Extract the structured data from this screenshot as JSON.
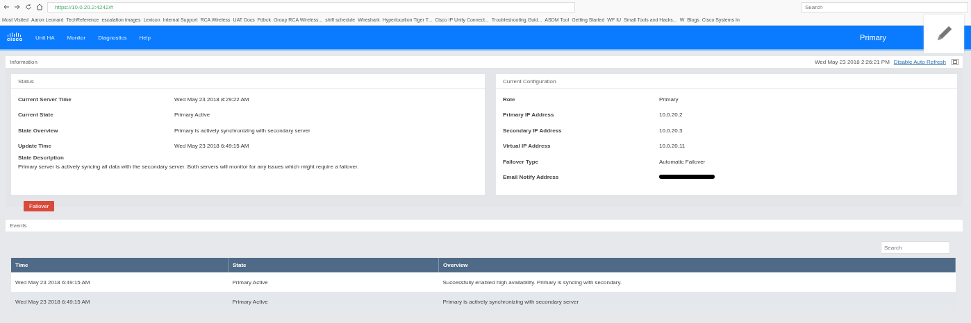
{
  "browser": {
    "url": "https://10.0.20.2:4242/#",
    "search_placeholder": "Search",
    "bookmarks": [
      "Most Visited",
      "Aaron Leonard",
      "TechReference",
      "escalation images",
      "Lexicon",
      "Internal Support",
      "RCA Wireless",
      "UAT Docs",
      "Fdbck",
      "Group RCA Wireless...",
      "shift schedule",
      "Wireshark",
      "Hyperlocation Tiger T...",
      "Cisco IP Unity Connect...",
      "Troubleshooting Guid...",
      "ASDM Tool",
      "Getting Started",
      "WF IU",
      "Small Tools and Hacks...",
      "W",
      "Blogs",
      "Cisco Systems In"
    ]
  },
  "nav": {
    "logo": "cisco",
    "items": [
      "Unit HA",
      "Monitor",
      "Diagnostics",
      "Help"
    ],
    "role": "Primary"
  },
  "info": {
    "title": "Information",
    "timestamp": "Wed May 23 2018 2:26:21 PM",
    "link": "Disable Auto Refresh"
  },
  "status": {
    "title": "Status",
    "rows": [
      {
        "label": "Current Server Time",
        "value": "Wed May 23 2018 8:29:22 AM"
      },
      {
        "label": "Current State",
        "value": "Primary Active"
      },
      {
        "label": "State Overview",
        "value": "Primary is actively synchronizing with secondary server"
      },
      {
        "label": "Update Time",
        "value": "Wed May 23 2018 6:49:15 AM"
      }
    ],
    "description_label": "State Description",
    "description": "Primary server is actively syncing all data with the secondary server. Both servers will monitor for any issues which might require a failover."
  },
  "failover_button": "Failover",
  "config": {
    "title": "Current Configuration",
    "rows": [
      {
        "label": "Role",
        "value": "Primary",
        "redacted": false
      },
      {
        "label": "Primary IP Address",
        "value": "10.0.20.2",
        "redacted": false
      },
      {
        "label": "Secondary IP Address",
        "value": "10.0.20.3",
        "redacted": false
      },
      {
        "label": "Virtual IP Address",
        "value": "10.0.20.11",
        "redacted": false
      },
      {
        "label": "Failover Type",
        "value": "Automatic Failover",
        "redacted": false
      },
      {
        "label": "Email Notify Address",
        "redacted": true
      }
    ]
  },
  "events": {
    "title": "Events",
    "search_placeholder": "Search",
    "columns": [
      "Time",
      "State",
      "Overview"
    ],
    "rows": [
      [
        "Wed May 23 2018 6:49:15 AM",
        "Primary Active",
        "Successfully enabled high availability. Primary is syncing with secondary."
      ],
      [
        "Wed May 23 2018 6:49:15 AM",
        "Primary Active",
        "Primary is actively synchronizing with secondary server"
      ]
    ]
  }
}
